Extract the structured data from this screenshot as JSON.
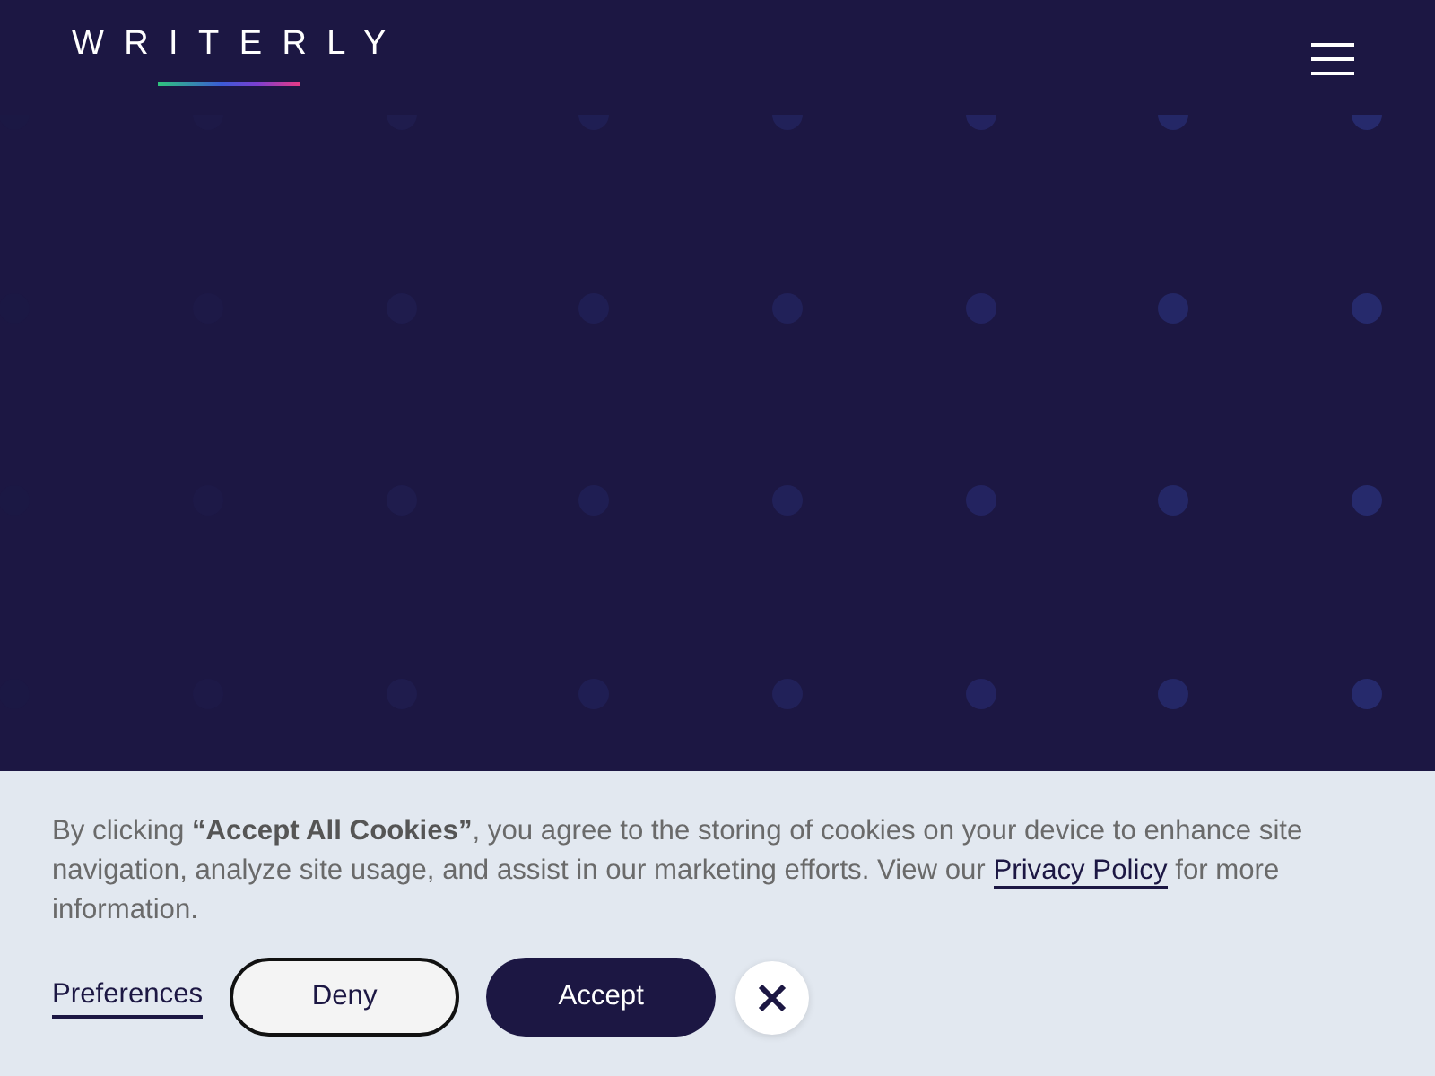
{
  "header": {
    "logo": "WRITERLY"
  },
  "cookie_banner": {
    "message": "By clicking **“Accept All Cookies”**, you agree to the storing of cookies on your device to enhance site navigation, analyze site usage, and assist in our marketing efforts. View our ",
    "link": "Privacy Policy",
    "message_end": " for more information.",
    "preferences": "Preferences",
    "buttons": [
      {
        "label": "Deny",
        "kind": "secondary"
      },
      {
        "label": "Accept",
        "kind": "primary"
      }
    ]
  }
}
